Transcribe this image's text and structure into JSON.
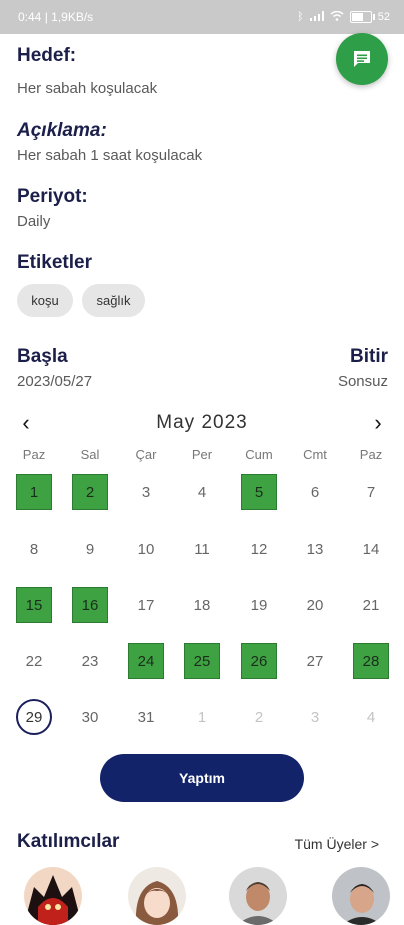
{
  "status_bar": {
    "time_speed": "0:44 | 1,9KB/s",
    "battery": "52",
    "icons": [
      "bluetooth-icon",
      "signal-icon",
      "wifi-icon",
      "battery-icon"
    ]
  },
  "goal": {
    "label": "Hedef:",
    "value": "Her sabah koşulacak"
  },
  "description": {
    "label": "Açıklama:",
    "value": "Her sabah 1 saat koşulacak"
  },
  "period": {
    "label": "Periyot:",
    "value": "Daily"
  },
  "tags": {
    "label": "Etiketler",
    "items": [
      "koşu",
      "sağlık"
    ]
  },
  "start": {
    "label": "Başla",
    "value": "2023/05/27"
  },
  "end": {
    "label": "Bitir",
    "value": "Sonsuz"
  },
  "calendar": {
    "month_year": "May  2023",
    "weekdays": [
      "Paz",
      "Sal",
      "Çar",
      "Per",
      "Cum",
      "Cmt",
      "Paz"
    ],
    "weeks": [
      [
        "1",
        "2",
        "3",
        "4",
        "5",
        "6",
        "7"
      ],
      [
        "8",
        "9",
        "10",
        "11",
        "12",
        "13",
        "14"
      ],
      [
        "15",
        "16",
        "17",
        "18",
        "19",
        "20",
        "21"
      ],
      [
        "22",
        "23",
        "24",
        "25",
        "26",
        "27",
        "28"
      ],
      [
        "29",
        "30",
        "31",
        "1",
        "2",
        "3",
        "4"
      ]
    ],
    "completed_days": [
      "1",
      "2",
      "5",
      "15",
      "16",
      "24",
      "25",
      "26",
      "28"
    ],
    "today": "29",
    "next_month_days": [
      "1",
      "2",
      "3",
      "4"
    ]
  },
  "done_button": "Yaptım",
  "participants": {
    "label": "Katılımcılar",
    "all_members": "Tüm Üyeler >"
  },
  "colors": {
    "accent": "#13236a",
    "done": "#3ea243",
    "fab": "#2e9e48"
  }
}
